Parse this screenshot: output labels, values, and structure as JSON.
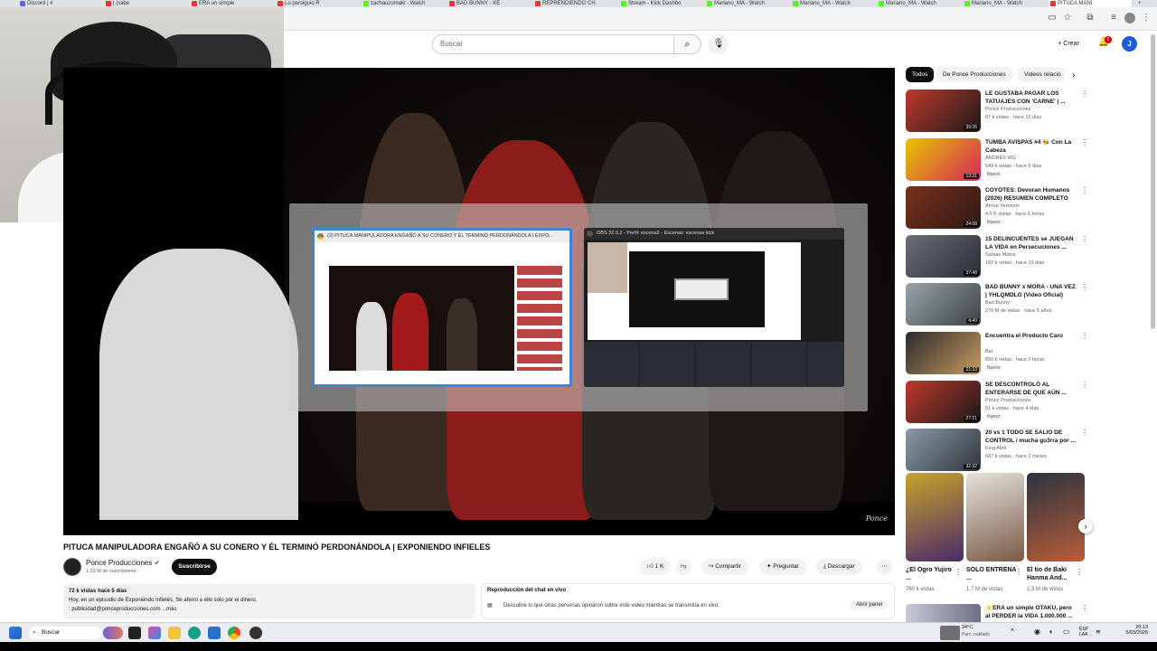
{
  "browser": {
    "tabs": [
      {
        "label": "Discord | #",
        "color": "#5865f2"
      },
      {
        "label": "| (sabe",
        "color": "#e33"
      },
      {
        "label": "ERA un simple",
        "color": "#e33"
      },
      {
        "label": "Lo persiguio R",
        "color": "#e33"
      },
      {
        "label": "zachauzumaki - Watch",
        "color": "#53fc18"
      },
      {
        "label": "BAD BUNNY - KE",
        "color": "#e33"
      },
      {
        "label": "REPRENDIENDO CH",
        "color": "#e33"
      },
      {
        "label": "Stream - Kick Dashbo",
        "color": "#53fc18"
      },
      {
        "label": "Mariano_MA - Watch",
        "color": "#53fc18"
      },
      {
        "label": "Mariano_MA - Watch",
        "color": "#53fc18"
      },
      {
        "label": "Mariano_MA - Watch",
        "color": "#53fc18"
      },
      {
        "label": "Mariano_MA - Watch",
        "color": "#53fc18"
      },
      {
        "label": "PITUCA MANI",
        "color": "#e33"
      }
    ],
    "new_tab": "+"
  },
  "header": {
    "search_placeholder": "Buscar",
    "create_label": "Crear",
    "notif_count": "2",
    "avatar_letter": "J"
  },
  "task_switcher": {
    "window1_title": "(2) PITUCA MANIPULADORA ENGAÑÓ A SU CONERO Y ÉL TERMINÓ PERDONÁNDOLA | EXPO...",
    "window2_title": "OBS 32.0.2 - Perfil: escena2 - Escenas: escenas kick"
  },
  "video": {
    "watermark": "Ponce",
    "title": "PITUCA MANIPULADORA ENGAÑÓ A SU CONERO Y ÉL TERMINÓ PERDONÁNDOLA | EXPONIENDO INFIELES",
    "channel": "Ponce Producciones",
    "subscribers": "1.01 M de suscriptores",
    "subscribe_label": "Suscribirse",
    "likes": "1 K",
    "share_label": "Compartir",
    "ask_label": "Preguntar",
    "download_label": "Descargar",
    "more_label": "⋯"
  },
  "description": {
    "stats": "72 k vistas  hace 5 días",
    "line1": "Hoy, en un episodio  de Exponiendo Infieles, Se aferró a ello solo por el dinero.",
    "line2": ": publicidad@ponceproducciones.com  ...más"
  },
  "chat_replay": {
    "title": "Reproducción del chat en vivo",
    "text": "Descubre lo que otras personas opinaron sobre este video mientras se transmitía en vivo.",
    "open_label": "Abrir panel"
  },
  "chips": [
    "Todos",
    "De Ponce Producciones",
    "Videos relacio"
  ],
  "recommendations": [
    {
      "title": "LE GUSTABA PAGAR LOS TATUAJES CON 'CARNE' | ...",
      "channel": "Ponce Producciones",
      "meta": "67 k vistas · hace 12 días",
      "duration": "39:26",
      "badge": "",
      "c1": "#c0392b",
      "c2": "#1a1a1a"
    },
    {
      "title": "TUMBA AVISPAS #4 🐝 Con La Cabeza",
      "channel": "ANDRÉS WG",
      "meta": "649 k vistas · hace 5 días",
      "duration": "13:31",
      "badge": "Nuevo",
      "c1": "#e8c300",
      "c2": "#d4285c"
    },
    {
      "title": "COYOTES: Devoran Humanos (2026) RESUMEN COMPLETO",
      "channel": "Ahora Veremos",
      "meta": "4.5 K vistas · hace 6 horas",
      "duration": "24:08",
      "badge": "Nuevo",
      "c1": "#7a2f1d",
      "c2": "#2c1a14"
    },
    {
      "title": "15 DELINCUENTES se JUEGAN LA VIDA en Persecuciones ...",
      "channel": "Santas Motos",
      "meta": "182 k vistas · hace 10 días",
      "duration": "37:48",
      "badge": "",
      "c1": "#6b6e75",
      "c2": "#2a2d33"
    },
    {
      "title": "BAD BUNNY x MORA - UNA VEZ | YHLQMDLG (Video Oficial)",
      "channel": "Bad Bunny",
      "meta": "270 M de vistas · hace 5 años",
      "duration": "4:40",
      "badge": "",
      "c1": "#9aa3a8",
      "c2": "#3c4246"
    },
    {
      "title": "Encuentra el Producto Caro",
      "channel": "Bai",
      "meta": "850 k vistas · hace 7 horas",
      "duration": "21:10",
      "badge": "Nuevo",
      "c1": "#2b2b2b",
      "c2": "#c79a62"
    },
    {
      "title": "SE DESCONTROLÓ AL ENTERARSE DE QUE AÚN ...",
      "channel": "Ponce Producciones",
      "meta": "51 k vistas · hace 4 días",
      "duration": "27:21",
      "badge": "Nuevo",
      "c1": "#c0392b",
      "c2": "#1a1a1a"
    },
    {
      "title": "20 vs 1 TODO SE SALIO DE CONTROL / mucha gu3rra por ...",
      "channel": "King Abril",
      "meta": "687 k vistas · hace 2 meses",
      "duration": "32:32",
      "badge": "",
      "c1": "#8a9aa8",
      "c2": "#30363c"
    }
  ],
  "shorts": [
    {
      "title": "¿El Ogro Yujiro ...",
      "views": "760 k vistas",
      "c1": "#c8a22a",
      "c2": "#4b2a6b"
    },
    {
      "title": "SOLO ENTRENA ...",
      "views": "1.7 M de vistas",
      "c1": "#e5e2dd",
      "c2": "#7a5a45"
    },
    {
      "title": "El tio de Baki Hanma And...",
      "views": "1.3 M de vistas",
      "c1": "#2b3340",
      "c2": "#b85d38"
    }
  ],
  "bottom_rec_title": "⭐ERA un simple OTAKU, pero al PERDER la VIDA 1.000.000 ...",
  "taskbar": {
    "search_placeholder": "Buscar",
    "weather_temp": "24°C",
    "weather_desc": "Parc. nublado",
    "lang": "ESP LAA",
    "time": "20:13",
    "date": "5/03/2026"
  }
}
